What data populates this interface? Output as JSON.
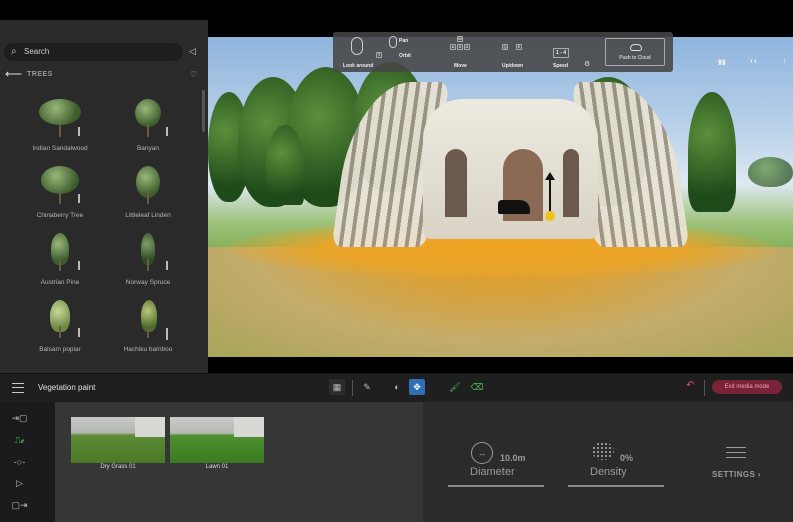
{
  "library": {
    "search_placeholder": "Search",
    "section_title": "TREES",
    "items": [
      {
        "label": "Indian Sandalwood"
      },
      {
        "label": "Banyan"
      },
      {
        "label": "Chinaberry Tree"
      },
      {
        "label": "Littleleaf Linden"
      },
      {
        "label": "Austrian Pine"
      },
      {
        "label": "Norway Spruce"
      },
      {
        "label": "Balsam poplar"
      },
      {
        "label": "Hachiku bamboo"
      }
    ]
  },
  "nav_controls": {
    "look_around": "Look around",
    "pan": "Pan",
    "orbit": "Orbit",
    "move": "Move",
    "updown": "Up/down",
    "speed": "Speed",
    "speed_keys": "1 - 4",
    "push_to_cloud": "Push to Cloud",
    "move_keys": [
      "W",
      "A",
      "S",
      "D"
    ],
    "updown_keys": [
      "Q",
      "E"
    ]
  },
  "toolbar": {
    "title": "Vegetation paint",
    "exit_label": "Exit media mode"
  },
  "assets": [
    {
      "label": "Dry Grass 01"
    },
    {
      "label": "Lawn 01"
    }
  ],
  "properties": {
    "diameter_value": "10.0m",
    "diameter_label": "Diameter",
    "density_value": "0%",
    "density_label": "Density",
    "settings_label": "SETTINGS"
  },
  "icons": {
    "search": "search-icon",
    "back": "back-arrow-icon",
    "favorite": "heart-icon",
    "menu": "hamburger-icon"
  },
  "colors": {
    "accent_blue": "#2e6fb5",
    "accent_green": "#4dc25a",
    "exit_bg": "#7a2238",
    "panel_bg": "#2a2a2a"
  }
}
